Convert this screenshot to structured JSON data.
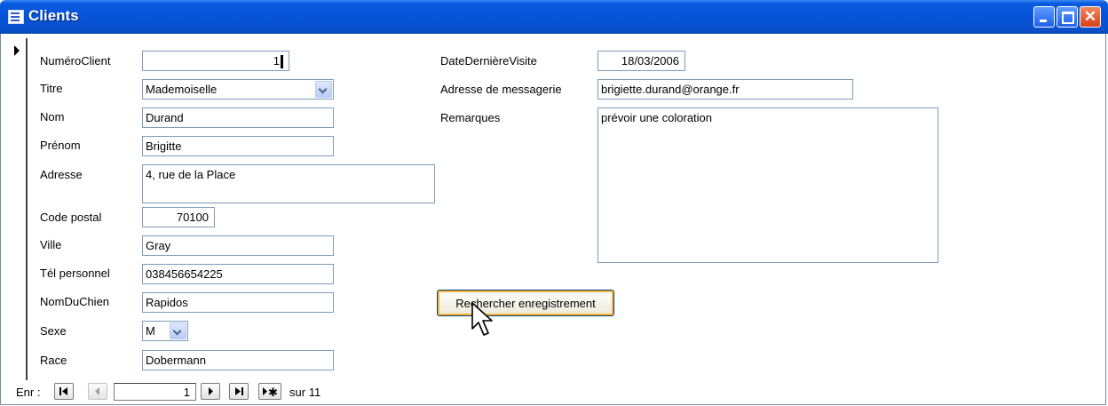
{
  "window": {
    "title": "Clients"
  },
  "form": {
    "left_fields": [
      {
        "label": "NuméroClient",
        "value": "1"
      },
      {
        "label": "Titre",
        "value": "Mademoiselle"
      },
      {
        "label": "Nom",
        "value": "Durand"
      },
      {
        "label": "Prénom",
        "value": "Brigitte"
      },
      {
        "label": "Adresse",
        "value": "4, rue de la Place"
      },
      {
        "label": "Code postal",
        "value": "70100"
      },
      {
        "label": "Ville",
        "value": "Gray"
      },
      {
        "label": "Tél personnel",
        "value": "038456654225"
      },
      {
        "label": "NomDuChien",
        "value": "Rapidos"
      },
      {
        "label": "Sexe",
        "value": "M"
      },
      {
        "label": "Race",
        "value": "Dobermann"
      }
    ],
    "right_fields": [
      {
        "label": "DateDernièreVisite",
        "value": "18/03/2006"
      },
      {
        "label": "Adresse de messagerie",
        "value": "brigiette.durand@orange.fr"
      },
      {
        "label": "Remarques",
        "value": "prévoir une coloration"
      }
    ],
    "search_button_label": "Rechercher enregistrement"
  },
  "navigation": {
    "record_label": "Enr :",
    "current_record": "1",
    "total_prefix": "sur",
    "total": "11"
  },
  "colors": {
    "titlebar": "#0553d8",
    "field_border": "#7f9db9",
    "button_focus": "#f8b33a"
  }
}
